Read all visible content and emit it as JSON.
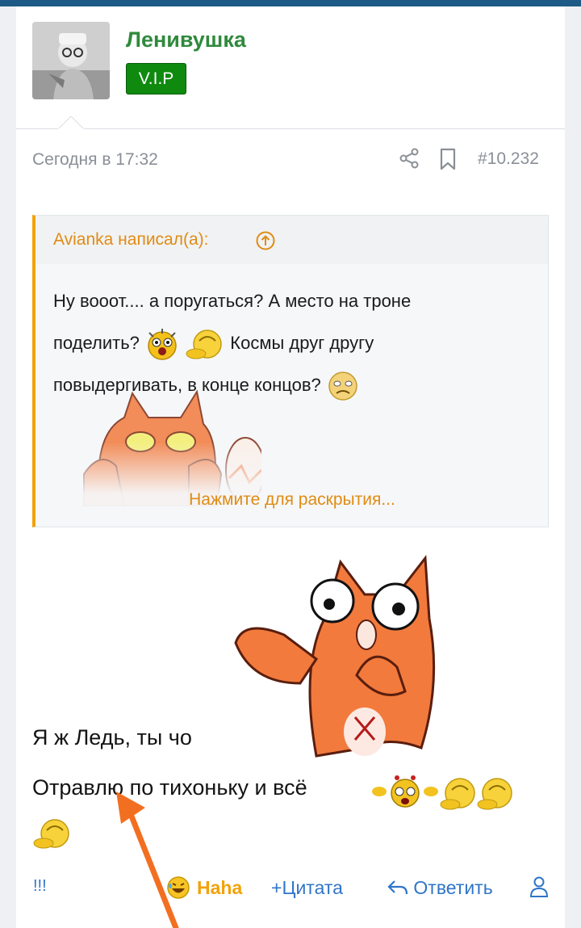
{
  "post": {
    "author": {
      "name": "Ленивушка",
      "badge": "V.I.P"
    },
    "time": "Сегодня в 17:32",
    "number": "#10.232",
    "quote": {
      "author": "Avianka написал(а):",
      "text_1": "Ну вооот.... а поругаться? А место на троне",
      "text_2a": "поделить?",
      "text_2b": "Космы друг другу",
      "text_3": "повыдергивать, в конце концов?",
      "expand": "Нажмите для раскрытия..."
    },
    "body": {
      "line_1": "Я ж Ледь, ты чо",
      "line_2": "Отравлю по тихоньку и всё"
    },
    "actions": {
      "exclaim": "!!!",
      "reaction": "Haha",
      "quote": "Цитата",
      "reply": "Ответить"
    }
  },
  "icons": [
    "share-icon",
    "bookmark-icon",
    "arrow-up-circle-icon",
    "laugh-emoji-icon",
    "reply-icon",
    "user-icon",
    "plus-icon"
  ],
  "colors": {
    "accent": "#2f75c8",
    "username": "#2f8a3c",
    "vip": "#0f8a0f",
    "quote_border": "#f1a20a",
    "topbar": "#1d5a85"
  }
}
